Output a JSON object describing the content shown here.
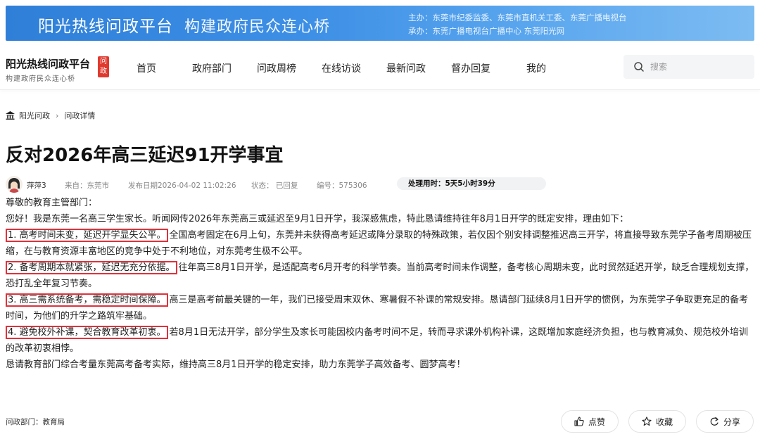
{
  "banner": {
    "title": "阳光热线问政平台",
    "subtitle": "构建政府民众连心桥",
    "sponsor": "主办：东莞市纪委监委、东莞市直机关工委、东莞广播电视台",
    "organizer": "承办：东莞广播电视台广播中心 东莞阳光网"
  },
  "logo": {
    "title": "阳光热线问政平台",
    "badge": "问政",
    "subtitle": "构建政府民众连心桥"
  },
  "nav": {
    "items": [
      "首页",
      "政府部门",
      "问政周榜",
      "在线访谈",
      "最新问政",
      "督办回复",
      "我的"
    ]
  },
  "search": {
    "placeholder": "搜索"
  },
  "breadcrumb": {
    "home": "阳光问政",
    "separator": "›",
    "current": "问政详情"
  },
  "post": {
    "title": "反对2026年高三延迟91开学事宜",
    "author": "萍萍3",
    "source": "来自：东莞市",
    "date": "发布日期2026-04-02 11:02:26",
    "status": "状态： 已回复",
    "number": "编号：575306",
    "process_time": "处理用时：5天5小时39分",
    "greeting": "尊敬的教育主管部门：",
    "intro": "您好！我是东莞一名高三学生家长。听闻网传2026年东莞高三或延迟至9月1日开学，我深感焦虑，特此恳请维持往年8月1日开学的既定安排，理由如下：",
    "points": [
      {
        "heading": "1. 高考时间未变，延迟开学显失公平。",
        "text": "全国高考固定在6月上旬，东莞并未获得高考延迟或降分录取的特殊政策，若仅因个别安排调整推迟高三开学，将直接导致东莞学子备考周期被压缩，在与教育资源丰富地区的竞争中处于不利地位，对东莞考生极不公平。"
      },
      {
        "heading": "2. 备考周期本就紧张，延迟无充分依据。",
        "text": "往年高三8月1日开学，是适配高考6月开考的科学节奏。当前高考时间未作调整，备考核心周期未变，此时贸然延迟开学，缺乏合理规划支撑，恐打乱全年复习节奏。"
      },
      {
        "heading": "3. 高三需系统备考，需稳定时间保障。",
        "text": "高三是高考前最关键的一年，我们已接受周末双休、寒暑假不补课的常规安排。恳请部门延续8月1日开学的惯例，为东莞学子争取更充足的备考时间，为他们的升学之路筑牢基础。"
      },
      {
        "heading": "4. 避免校外补课，契合教育改革初衷。",
        "text": "若8月1日无法开学，部分学生及家长可能因校内备考时间不足，转而寻求课外机构补课，这既增加家庭经济负担，也与教育减负、规范校外培训的改革初衷相悖。"
      }
    ],
    "closing": "恳请教育部门综合考量东莞高考备考实际，维持高三8月1日开学的稳定安排，助力东莞学子高效备考、圆梦高考！",
    "department": "问政部门：教育局"
  },
  "actions": {
    "like": "点赞",
    "favorite": "收藏",
    "share": "分享"
  },
  "colors": {
    "accent": "#e0313b",
    "banner": "#3d8fe6"
  }
}
